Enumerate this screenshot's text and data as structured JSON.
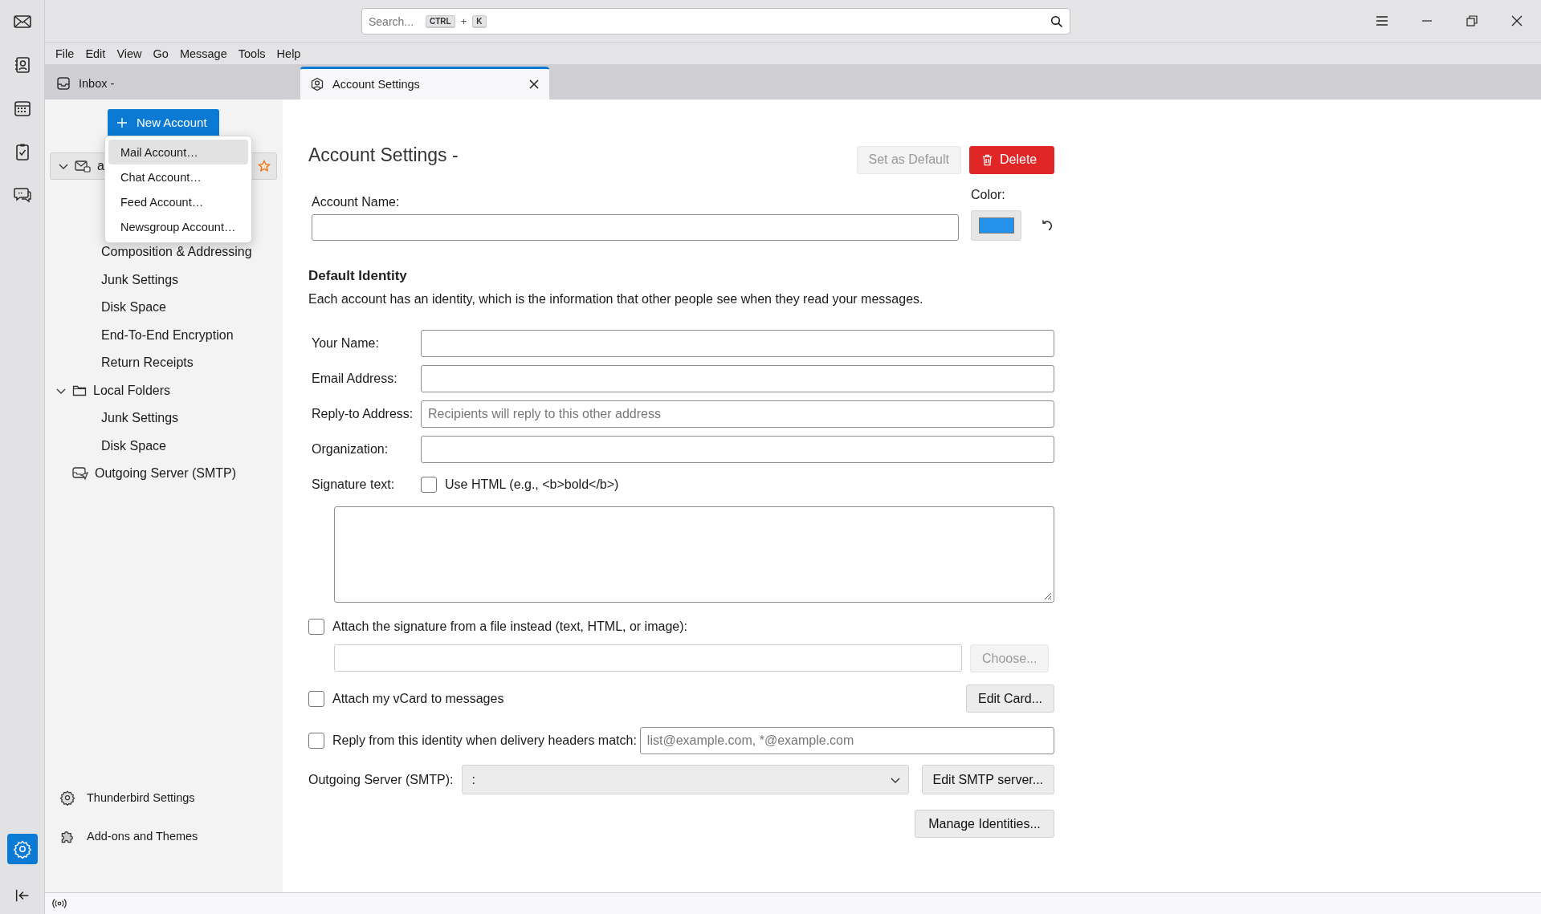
{
  "spaces": [
    {
      "kind": "mail",
      "selected": false
    },
    {
      "kind": "contacts",
      "selected": false
    },
    {
      "kind": "calendar",
      "selected": false
    },
    {
      "kind": "tasks",
      "selected": false
    },
    {
      "kind": "chat",
      "selected": false
    },
    {
      "kind": "settings",
      "selected": true
    }
  ],
  "search": {
    "placeholder": "Search...",
    "shortcut_keys": [
      "CTRL",
      "K"
    ],
    "shortcut_joiner": "+"
  },
  "menu_bar": [
    "File",
    "Edit",
    "View",
    "Go",
    "Message",
    "Tools",
    "Help"
  ],
  "tabs": [
    {
      "label": "Inbox -",
      "kind": "mail",
      "selected": false
    },
    {
      "label": "Account Settings",
      "kind": "settings",
      "selected": true
    }
  ],
  "sidebar": {
    "new_account_button": "New Account",
    "tree": [
      {
        "label": "a",
        "kind": "account",
        "selected": true,
        "expanded": true,
        "children": [
          {
            "label": "Composition & Addressing",
            "selected": false
          },
          {
            "label": "Junk Settings",
            "selected": false
          },
          {
            "label": "Disk Space",
            "selected": false
          },
          {
            "label": "End-To-End Encryption",
            "selected": false
          },
          {
            "label": "Return Receipts",
            "selected": false
          }
        ]
      },
      {
        "label": "Local Folders",
        "kind": "folder",
        "selected": false,
        "expanded": true,
        "children": [
          {
            "label": "Junk Settings",
            "selected": false
          },
          {
            "label": "Disk Space",
            "selected": false
          }
        ]
      },
      {
        "label": "Outgoing Server (SMTP)",
        "kind": "smtp",
        "selected": false
      }
    ],
    "footer": [
      {
        "label": "Thunderbird Settings",
        "kind": "settings"
      },
      {
        "label": "Add-ons and Themes",
        "kind": "addons"
      }
    ]
  },
  "new_account_menu": [
    {
      "label": "Mail Account…",
      "selected": true
    },
    {
      "label": "Chat Account…",
      "selected": false
    },
    {
      "label": "Feed Account…",
      "selected": false
    },
    {
      "label": "Newsgroup Account…",
      "selected": false
    }
  ],
  "account_settings": {
    "title": "Account Settings -",
    "set_default_button": {
      "label": "Set as Default",
      "disabled": true
    },
    "delete_button": "Delete",
    "account_name_label": "Account Name:",
    "color_label": "Color:",
    "identity_heading": "Default Identity",
    "identity_description": "Each account has an identity, which is the information that other people see when they read your messages.",
    "identity_fields": [
      {
        "label": "Your Name:"
      },
      {
        "label": "Email Address:"
      },
      {
        "label": "Reply-to Address:",
        "placeholder": "Recipients will reply to this other address"
      },
      {
        "label": "Organization:"
      }
    ],
    "signature_label": "Signature text:",
    "use_html": {
      "label": "Use HTML (e.g., <b>bold</b>)",
      "checked": false
    },
    "attach_signature": {
      "label": "Attach the signature from a file instead (text, HTML, or image):",
      "checked": false
    },
    "choose_button": {
      "label": "Choose...",
      "disabled": true
    },
    "attach_vcard": {
      "label": "Attach my vCard to messages",
      "checked": false
    },
    "edit_card_button": "Edit Card...",
    "reply_from_identity": {
      "label": "Reply from this identity when delivery headers match:",
      "checked": false,
      "placeholder": "list@example.com, *@example.com"
    },
    "outgoing_server": {
      "label": "Outgoing Server (SMTP):",
      "value": ":"
    },
    "edit_smtp_button": "Edit SMTP server...",
    "manage_identities_button": "Manage Identities..."
  }
}
